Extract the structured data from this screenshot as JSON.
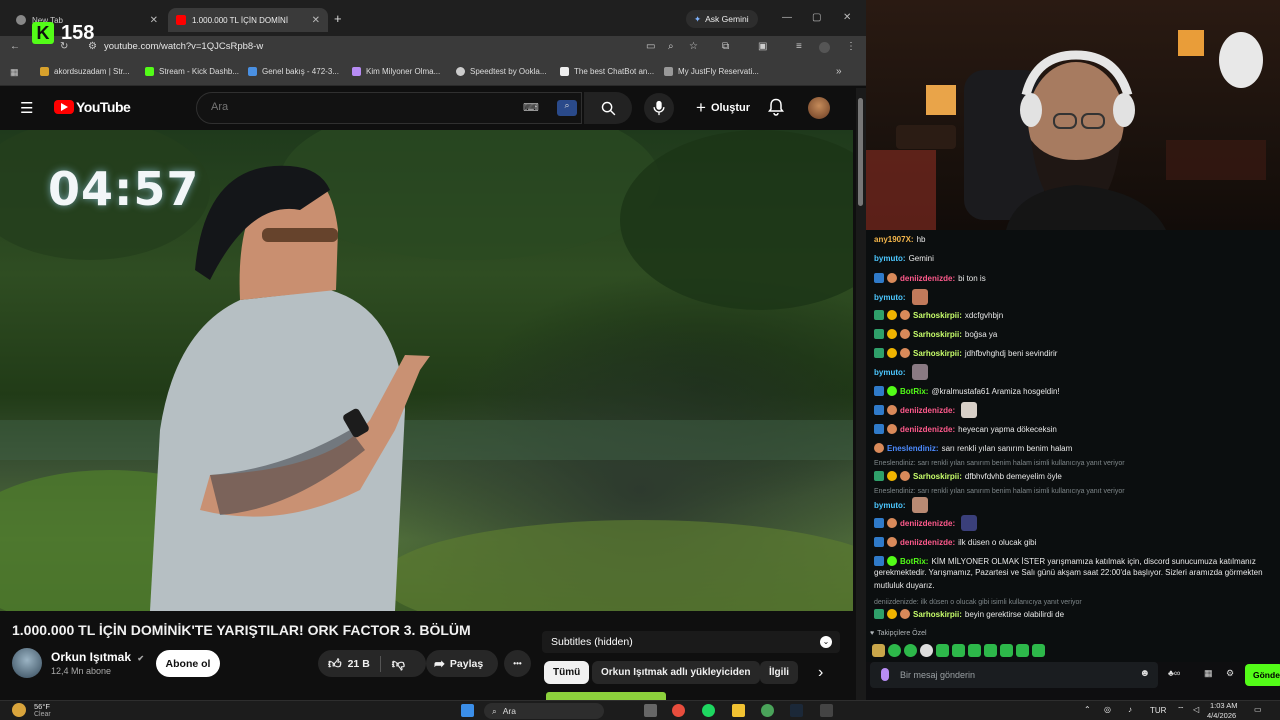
{
  "browser": {
    "tabs": [
      {
        "label": "New Tab"
      },
      {
        "label": "1.000.000 TL İÇİN DOMİNİ"
      }
    ],
    "new_tab_symbol": "+",
    "ask_gemini": "Ask Gemini",
    "url": "youtube.com/watch?v=1QJCsRpb8-w",
    "bookmarks": [
      "akordsuzadam | Str...",
      "Stream - Kick Dashb...",
      "Genel bakış - 472-3...",
      "Kim Milyoner Olma...",
      "Speedtest by Ookla...",
      "The best ChatBot an...",
      "My JustFly Reservati..."
    ],
    "bookmark_overflow": "»"
  },
  "kick_overlay": {
    "logo": "K",
    "viewer_count": "158"
  },
  "youtube": {
    "logo_text": "YouTube",
    "search_placeholder": "Ara",
    "create_label": "Oluştur",
    "video": {
      "timer": "04:57",
      "title": "1.000.000 TL İÇİN DOMİNİK'TE YARIŞTILAR! ORK FACTOR 3. BÖLÜM",
      "channel": "Orkun Işıtmak",
      "subscribers": "12,4 Mn abone",
      "subscribe_label": "Abone ol",
      "likes": "21 B",
      "share_label": "Paylaş",
      "more_label": "•••"
    },
    "subtitles_label": "Subtitles (hidden)",
    "chips": [
      "Tümü",
      "Orkun Işıtmak adlı yükleyiciden",
      "İlgili"
    ],
    "chips_next": "›"
  },
  "chat": {
    "messages": [
      {
        "user": "any1907X:",
        "text": "hb",
        "color": "#f4b64b"
      },
      {
        "user": "bymuto:",
        "text": "Gemini",
        "color": "#4cc7ff"
      },
      {
        "user": "deniizdenizde:",
        "text": "bi ton is",
        "color": "#ff5a8c"
      },
      {
        "user": "bymuto:",
        "text": "",
        "color": "#4cc7ff"
      },
      {
        "user": "Sarhoskirpii:",
        "text": "xdcfgvhbjn",
        "color": "#c8ff6b"
      },
      {
        "user": "Sarhoskirpii:",
        "text": "boğsa ya",
        "color": "#c8ff6b"
      },
      {
        "user": "Sarhoskirpii:",
        "text": "jdhfbvhghdj beni sevindirir",
        "color": "#c8ff6b"
      },
      {
        "user": "bymuto:",
        "text": "",
        "color": "#4cc7ff"
      },
      {
        "user": "BotRix:",
        "text": "@kralmustafa61 Aramiza hosgeldin!",
        "color": "#53fc18"
      },
      {
        "user": "deniizdenizde:",
        "text": "",
        "color": "#ff5a8c"
      },
      {
        "user": "deniizdenizde:",
        "text": "heyecan yapma dökeceksin",
        "color": "#ff5a8c"
      },
      {
        "user": "Eneslendiniz:",
        "text": "sarı renkli yılan sanırım benim halam",
        "color": "#4c8bff"
      },
      {
        "user": "Sarhoskirpii:",
        "text": "dfbhvfdvhb demeyelim öyle",
        "color": "#c8ff6b"
      },
      {
        "user": "bymuto:",
        "text": "",
        "color": "#4cc7ff"
      },
      {
        "user": "deniizdenizde:",
        "text": "",
        "color": "#ff5a8c"
      },
      {
        "user": "deniizdenizde:",
        "text": "ilk düsen o olucak gibi",
        "color": "#ff5a8c"
      },
      {
        "user": "BotRix:",
        "text": "KİM MİLYONER OLMAK İSTER yarışmamıza katılmak için, discord sunucumuza katılmanız",
        "color": "#53fc18"
      },
      {
        "user": "Sarhoskirpii:",
        "text": "beyin gerektirse olabilirdi de",
        "color": "#c8ff6b"
      }
    ],
    "botrix_line2": "gerekmektedir. Yarışmamız, Pazartesi ve Salı günü akşam saat 22:00'da başlıyor. Sizleri aramızda görmekten",
    "botrix_line3": "mutluluk duyarız.",
    "reply1": "Eneslendiniz: sarı renkli yılan sanırım benim halam isimli kullanıcıya yanıt veriyor",
    "reply2": "Eneslendiniz: sarı renkli yılan sanırım benim halam isimli kullanıcıya yanıt veriyor",
    "reply3": "deniizdenizde: ilk düsen o olucak gibi isimli kullanıcıya yanıt veriyor",
    "followers_label": "Takipçilere Özel",
    "input_placeholder": "Bir mesaj gönderin",
    "send_label": "Gönder"
  },
  "taskbar": {
    "weather_temp": "56°F",
    "weather_desc": "Clear",
    "search_label": "Ara",
    "lang": "TUR",
    "time": "1:03 AM",
    "date": "4/4/2026"
  },
  "colors": {
    "kick_green": "#53fc18",
    "youtube_red": "#ff0000"
  }
}
